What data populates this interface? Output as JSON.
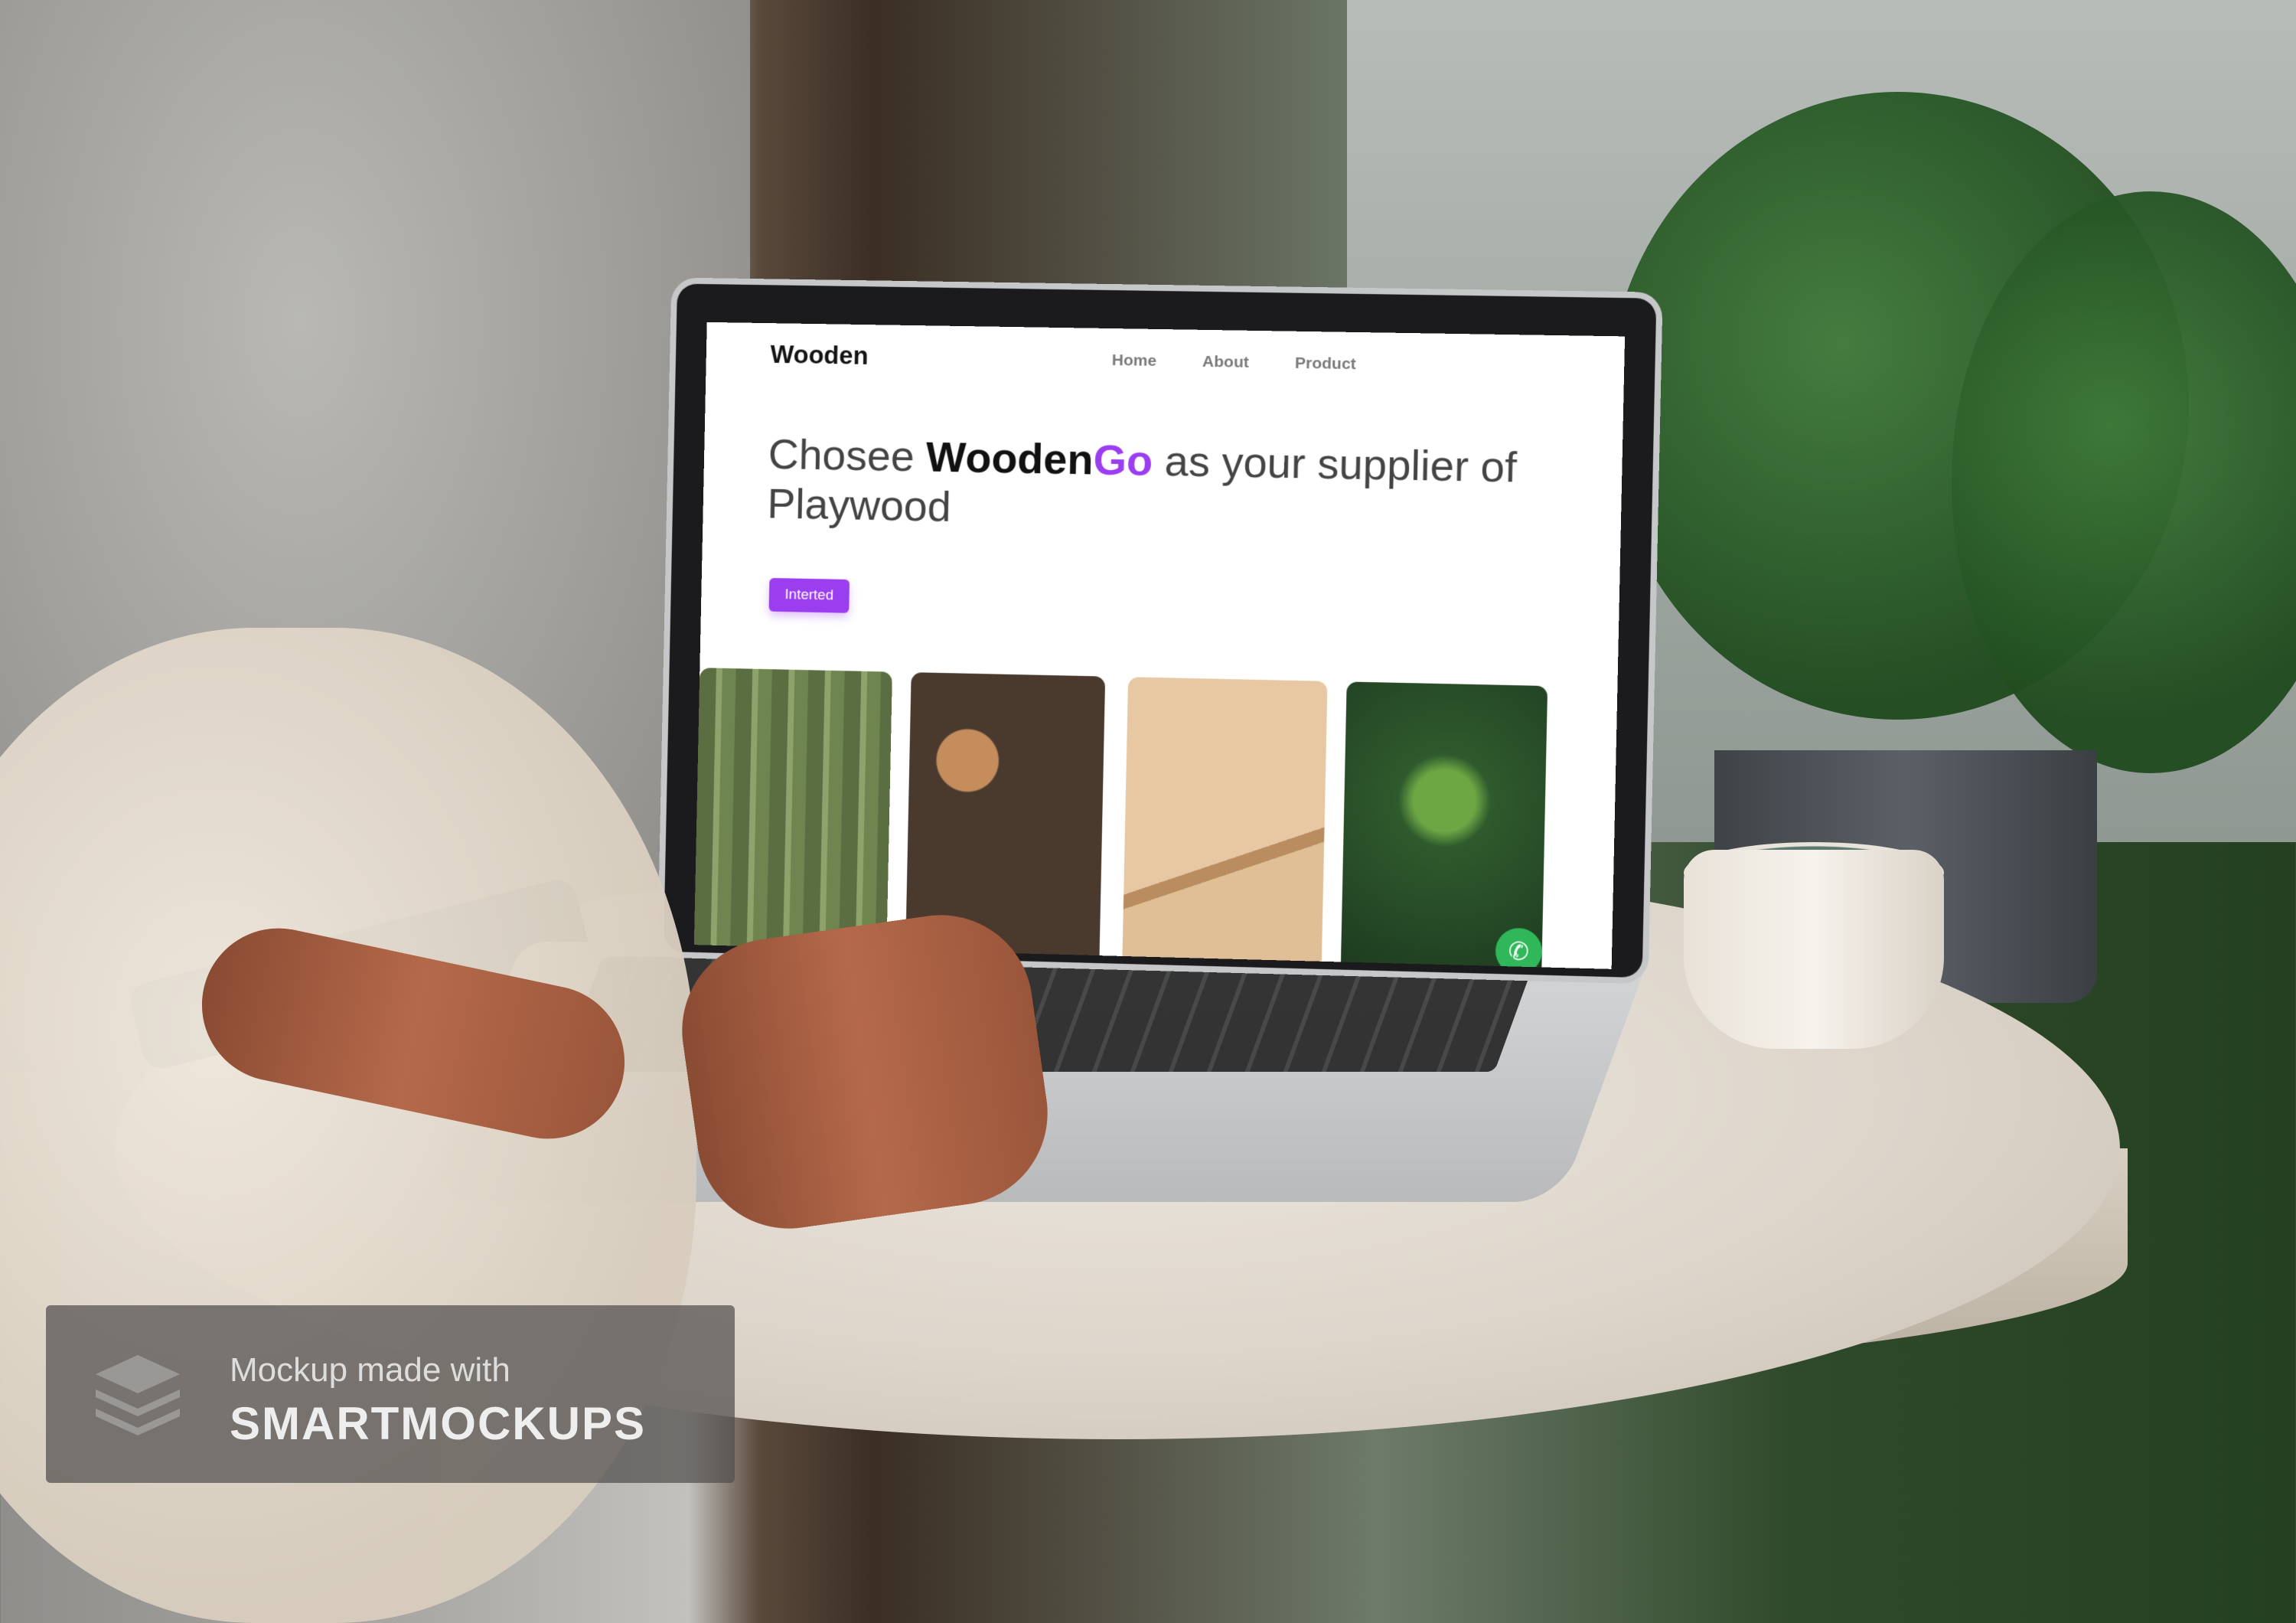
{
  "site": {
    "brand": "Wooden",
    "nav": [
      {
        "label": "Home"
      },
      {
        "label": "About"
      },
      {
        "label": "Product"
      }
    ],
    "hero": {
      "prefix": "Chosee ",
      "brand_main": "Wooden",
      "brand_accent": "Go",
      "suffix": " as your supplier of",
      "line2": "Playwood"
    },
    "cta_label": "Interted",
    "gallery": [
      {
        "name": "forest"
      },
      {
        "name": "logs"
      },
      {
        "name": "plywood"
      },
      {
        "name": "seedling"
      }
    ],
    "floating_icon": "whatsapp-icon"
  },
  "watermark": {
    "line1": "Mockup made with",
    "line2": "SMARTMOCKUPS",
    "icon": "layers-icon"
  },
  "colors": {
    "accent": "#9b3ef0",
    "whatsapp": "#2fb75a"
  }
}
